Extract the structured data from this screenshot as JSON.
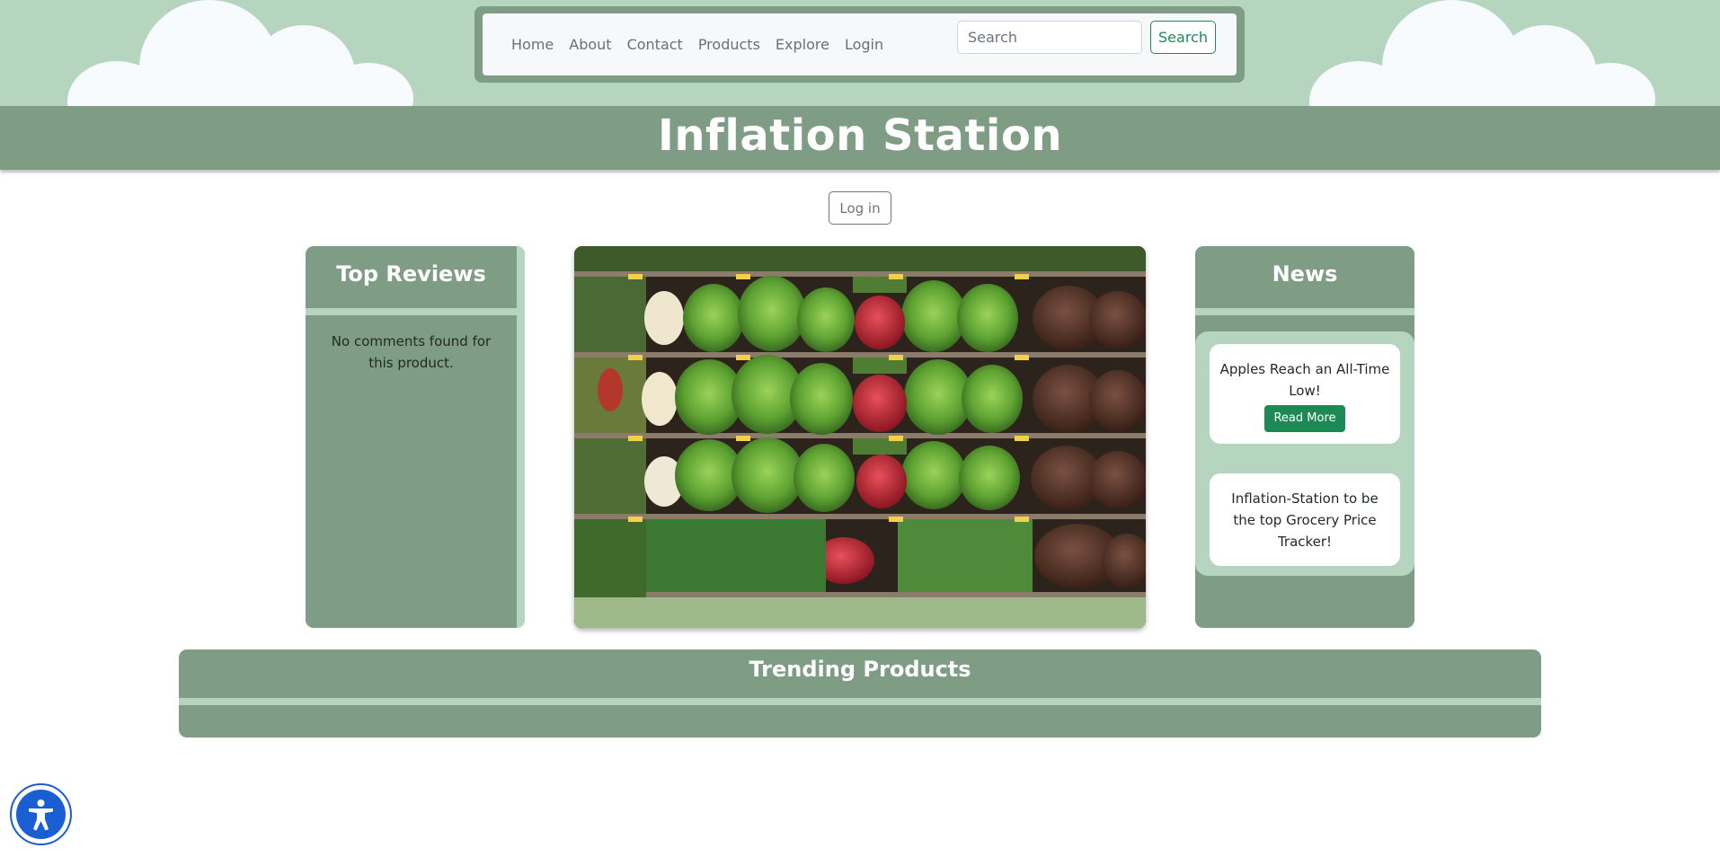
{
  "nav": {
    "links": [
      "Home",
      "About",
      "Contact",
      "Products",
      "Explore",
      "Login"
    ],
    "search_placeholder": "Search",
    "search_button": "Search"
  },
  "banner": {
    "title": "Inflation Station"
  },
  "auth": {
    "login_button": "Log in"
  },
  "reviews": {
    "title": "Top Reviews",
    "empty_message": "No comments found for this product."
  },
  "hero": {
    "icon": "produce-shelf-photo"
  },
  "news": {
    "title": "News",
    "items": [
      {
        "headline": "Apples Reach an All-Time Low!",
        "button": "Read More"
      },
      {
        "headline": "Inflation-Station to be the top Grocery Price Tracker!"
      }
    ]
  },
  "trending": {
    "title": "Trending Products"
  },
  "accessibility": {
    "icon": "accessibility-icon"
  },
  "colors": {
    "sky": "#b5d5bf",
    "panel": "#7f9d85",
    "accent_green": "#1d8a55",
    "accessibility_blue": "#1b5ed4"
  }
}
